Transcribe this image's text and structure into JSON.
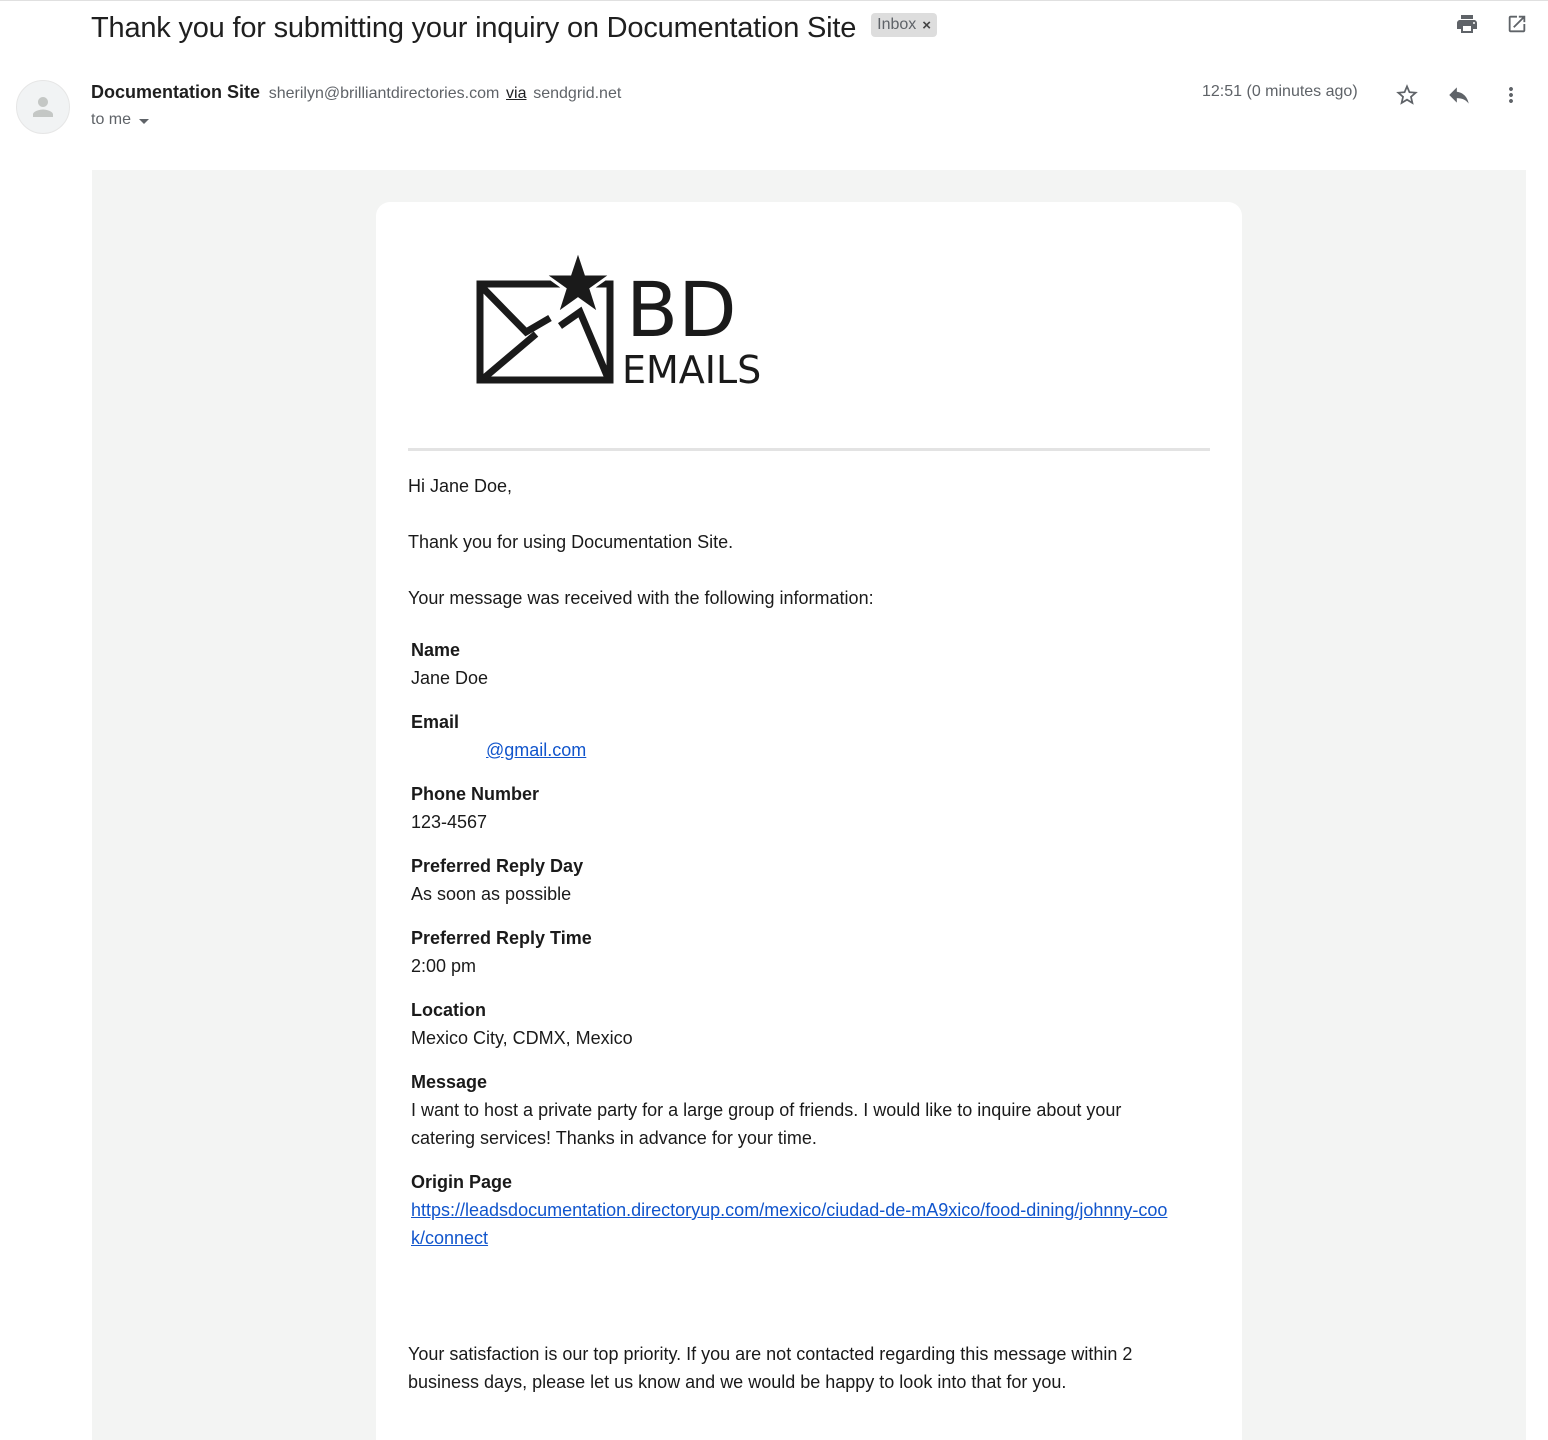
{
  "subject": "Thank you for submitting your inquiry on Documentation Site",
  "label": "Inbox",
  "label_remove": "×",
  "top_icons": [
    "print-icon",
    "open-in-new-window-icon"
  ],
  "sender": {
    "name": "Documentation Site",
    "email": "sherilyn@brilliantdirectories.com",
    "via_label": "via",
    "via_domain": "sendgrid.net",
    "to": "to me",
    "time": "12:51 (0 minutes ago)"
  },
  "actions": [
    "star-icon",
    "reply-icon",
    "more-options-icon"
  ],
  "email": {
    "logo": {
      "big": "BD",
      "small": "EMAILS"
    },
    "greeting": "Hi Jane Doe,",
    "thanks": "Thank you for using Documentation Site.",
    "intro": "Your message was received with the following information:",
    "fields": {
      "name": {
        "label": "Name",
        "value": "Jane Doe"
      },
      "email": {
        "label": "Email",
        "value": "@gmail.com"
      },
      "phone": {
        "label": "Phone Number",
        "value": "123-4567"
      },
      "reply_day": {
        "label": "Preferred Reply Day",
        "value": "As soon as possible"
      },
      "reply_time": {
        "label": "Preferred Reply Time",
        "value": "2:00 pm"
      },
      "location": {
        "label": "Location",
        "value": "Mexico City, CDMX, Mexico"
      },
      "message": {
        "label": "Message",
        "value": "I want to host a private party for a large group of friends. I would like to inquire about your catering services! Thanks in advance for your time."
      },
      "origin": {
        "label": "Origin Page",
        "value": "https://leadsdocumentation.directoryup.com/mexico/ciudad-de-mA9xico/food-dining/johnny-cook/connect"
      }
    },
    "closing": "Your satisfaction is our top priority. If you are not contacted regarding this message within 2 business days, please let us know and we would be happy to look into that for you."
  },
  "colors": {
    "link": "#1155cc",
    "frame_bg": "#f3f4f3",
    "chip_bg": "#dddddd"
  }
}
